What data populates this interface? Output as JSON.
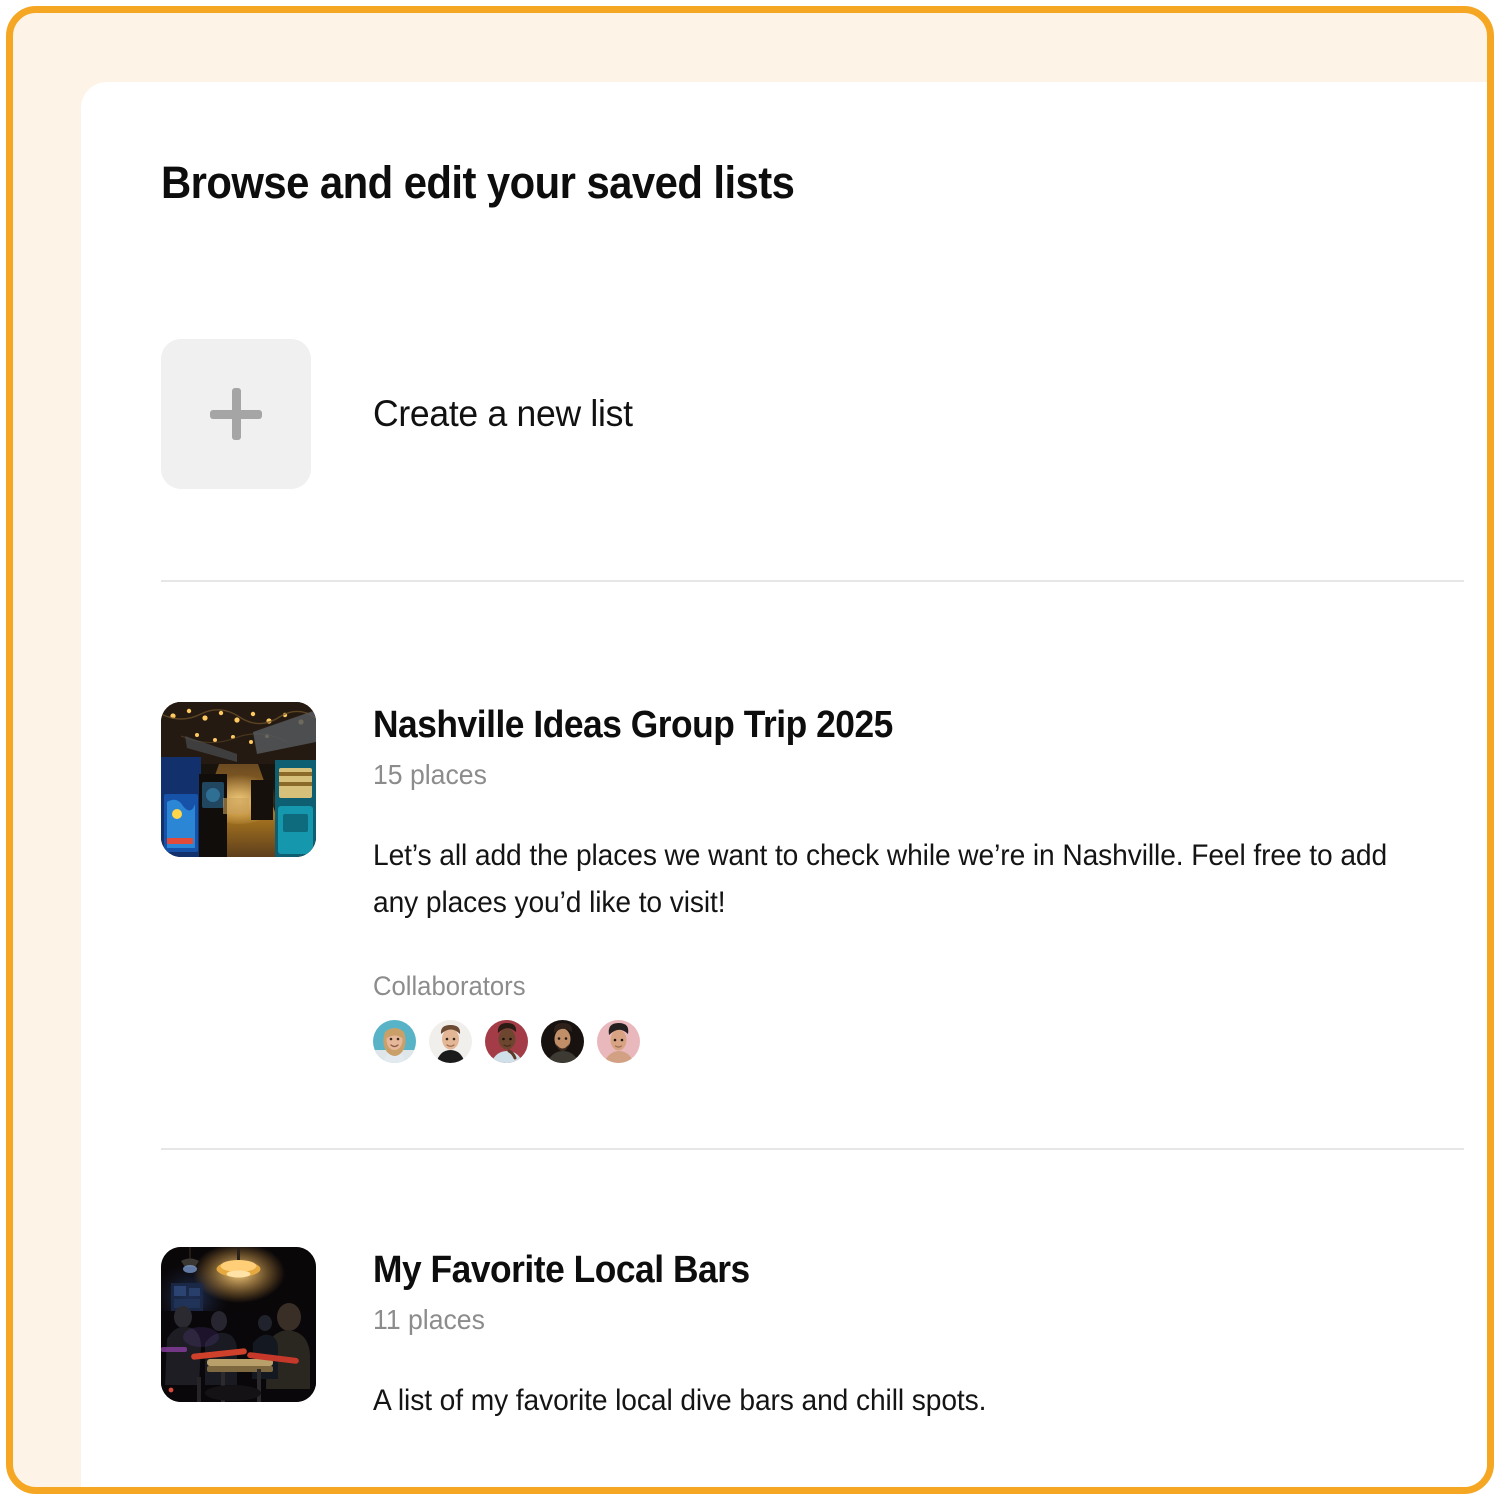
{
  "theme": {
    "frame_border_color": "#F5A623",
    "frame_background_color": "#FDF4E7",
    "card_background_color": "#FFFFFF",
    "divider_color": "#E6E6E6",
    "muted_text_color": "#8C8C8C",
    "primary_text_color": "#0D0D0D",
    "placeholder_tile_color": "#F0F0F0",
    "plus_icon_color": "#A5A5A5"
  },
  "page": {
    "title": "Browse and edit your saved lists"
  },
  "create_list": {
    "label": "Create a new list",
    "icon": "plus-icon"
  },
  "lists": [
    {
      "title": "Nashville Ideas Group Trip 2025",
      "count": "15 places",
      "description": "Let’s all add the places we want to check while we’re in Nashville. Feel free to add any places you’d like to visit!",
      "thumbnail_alt": "arcade-bar-interior-with-string-lights",
      "collaborators_label": "Collaborators",
      "collaborators": [
        {
          "name": "collaborator-1",
          "bg": "#58b3c7",
          "skin": "#e7b79a",
          "hair": "#caa06a",
          "shirt": "#dfe6ea"
        },
        {
          "name": "collaborator-2",
          "bg": "#f0efec",
          "skin": "#e3b695",
          "hair": "#6b4b33",
          "shirt": "#1b1b1b"
        },
        {
          "name": "collaborator-3",
          "bg": "#a33c46",
          "skin": "#6d4630",
          "hair": "#2a1c14",
          "shirt": "#cfe0ea"
        },
        {
          "name": "collaborator-4",
          "bg": "#17120f",
          "skin": "#c08f68",
          "hair": "#2e2119",
          "shirt": "#3c3a33"
        },
        {
          "name": "collaborator-5",
          "bg": "#e9b8bd",
          "skin": "#d8a383",
          "hair": "#23201f",
          "shirt": "#d2a183"
        }
      ]
    },
    {
      "title": "My Favorite Local Bars",
      "count": "11 places",
      "description": "A list of my favorite local dive bars and chill spots.",
      "thumbnail_alt": "dark-bar-with-live-band-and-pendant-lamp",
      "collaborators_label": "",
      "collaborators": []
    }
  ]
}
